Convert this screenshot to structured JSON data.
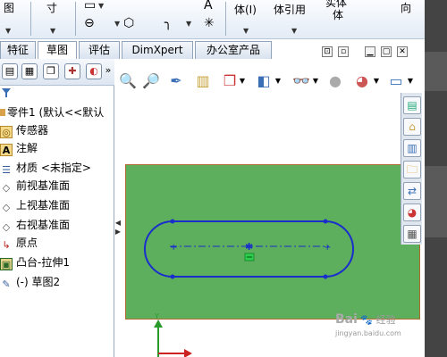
{
  "ribbon": {
    "label_left": "图",
    "label_cun": "寸",
    "label_ti": "体(I)",
    "label_tiyinyong": "体引用",
    "label_shiti": "实体",
    "label_ti2": "体",
    "label_xiang": "向"
  },
  "tabs": [
    {
      "label": "特征"
    },
    {
      "label": "草图"
    },
    {
      "label": "评估"
    },
    {
      "label": "DimXpert"
    },
    {
      "label": "办公室产品"
    }
  ],
  "tree": {
    "items": [
      {
        "label": "零件1 (默认<<默认",
        "icon": "part-icon"
      },
      {
        "label": "传感器",
        "icon": "sensor-icon"
      },
      {
        "label": "注解",
        "icon": "annotation-icon"
      },
      {
        "label": "材质 <未指定>",
        "icon": "material-icon"
      },
      {
        "label": "前视基准面",
        "icon": "plane-icon"
      },
      {
        "label": "上视基准面",
        "icon": "plane-icon"
      },
      {
        "label": "右视基准面",
        "icon": "plane-icon"
      },
      {
        "label": "原点",
        "icon": "origin-icon"
      },
      {
        "label": "凸台-拉伸1",
        "icon": "extrude-icon"
      },
      {
        "label": "(-) 草图2",
        "icon": "sketch-icon"
      }
    ]
  },
  "axes": {
    "y": "Y",
    "x": "X"
  },
  "watermark": {
    "line1": "Bai",
    "line2": "经验",
    "line3": "jingyan.baidu.com"
  },
  "colors": {
    "plane": "#5daf5e",
    "sketch": "#1a2ecc",
    "selected": "#2bd14a"
  }
}
